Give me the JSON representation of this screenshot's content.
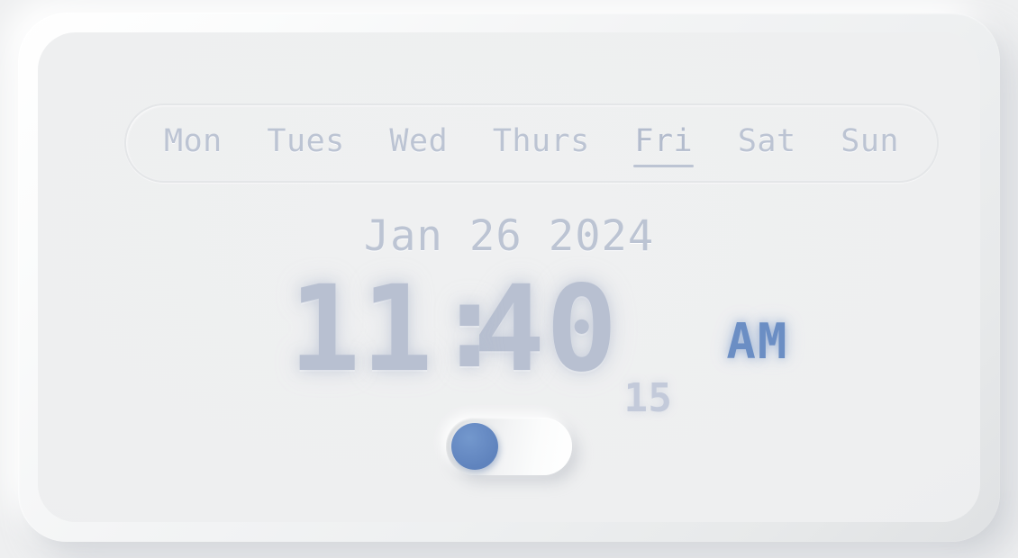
{
  "widget": {
    "name": "neumorphic-digital-clock",
    "background_color": "#eeeff0",
    "card_color": "#eef0f1"
  },
  "day_selector": {
    "active_day": "Fri",
    "days": [
      {
        "label": "Mon",
        "active": false
      },
      {
        "label": "Tues",
        "active": false
      },
      {
        "label": "Wed",
        "active": false
      },
      {
        "label": "Thurs",
        "active": false
      },
      {
        "label": "Fri",
        "active": true
      },
      {
        "label": "Sat",
        "active": false
      },
      {
        "label": "Sun",
        "active": false
      }
    ]
  },
  "date": {
    "text": "Jan 26 2024",
    "month": "Jan",
    "day": "26",
    "year": "2024"
  },
  "time": {
    "hours": "11",
    "separator": ":",
    "minutes": "40",
    "seconds": "15",
    "meridiem": "AM",
    "full": "11:40:15 AM",
    "digit_color": "#b8c0d1",
    "seconds_color": "#c3cada",
    "meridiem_color": "#6b8ec4"
  },
  "toggle": {
    "state": "off",
    "knob_position": "left",
    "knob_color": "#6489c4",
    "track_color": "#f0f1f2"
  }
}
